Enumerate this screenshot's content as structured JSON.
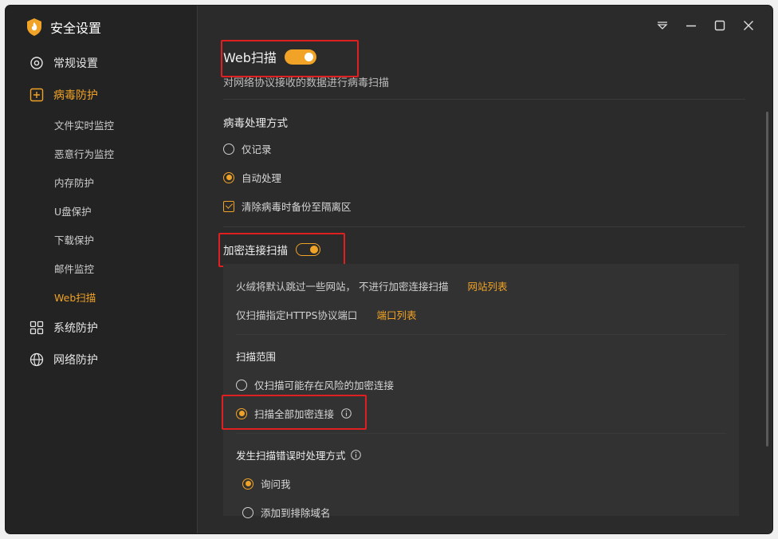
{
  "app": {
    "title": "安全设置"
  },
  "sidebar": {
    "items": [
      {
        "label": "常规设置",
        "icon": "gear-icon"
      },
      {
        "label": "病毒防护",
        "icon": "plus-square-icon"
      },
      {
        "label": "系统防护",
        "icon": "grid-icon"
      },
      {
        "label": "网络防护",
        "icon": "globe-icon"
      }
    ],
    "subitems": [
      "文件实时监控",
      "恶意行为监控",
      "内存防护",
      "U盘保护",
      "下载保护",
      "邮件监控",
      "Web扫描"
    ],
    "active_item": "病毒防护",
    "active_subitem": "Web扫描"
  },
  "window_controls": [
    "menu-icon",
    "minimize-icon",
    "maximize-icon",
    "close-icon"
  ],
  "web_scan": {
    "title": "Web扫描",
    "enabled": true,
    "description": "对网络协议接收的数据进行病毒扫描"
  },
  "virus_handling": {
    "title": "病毒处理方式",
    "options": [
      "仅记录",
      "自动处理"
    ],
    "selected": "自动处理",
    "backup_checkbox": {
      "label": "清除病毒时备份至隔离区",
      "checked": true
    }
  },
  "encrypted_scan": {
    "title": "加密连接扫描",
    "enabled": true,
    "skip_text": "火绒将默认跳过一些网站， 不进行加密连接扫描",
    "skip_link": "网站列表",
    "port_text": "仅扫描指定HTTPS协议端口",
    "port_link": "端口列表",
    "scope_title": "扫描范围",
    "scope_options": [
      "仅扫描可能存在风险的加密连接",
      "扫描全部加密连接"
    ],
    "scope_selected": "扫描全部加密连接",
    "error_title": "发生扫描错误时处理方式",
    "error_options": [
      "询问我",
      "添加到排除域名"
    ],
    "error_selected": "询问我"
  },
  "colors": {
    "accent": "#f0a326",
    "highlight_box": "#e02020",
    "background": "#2b2b2b",
    "sidebar": "#232323"
  }
}
